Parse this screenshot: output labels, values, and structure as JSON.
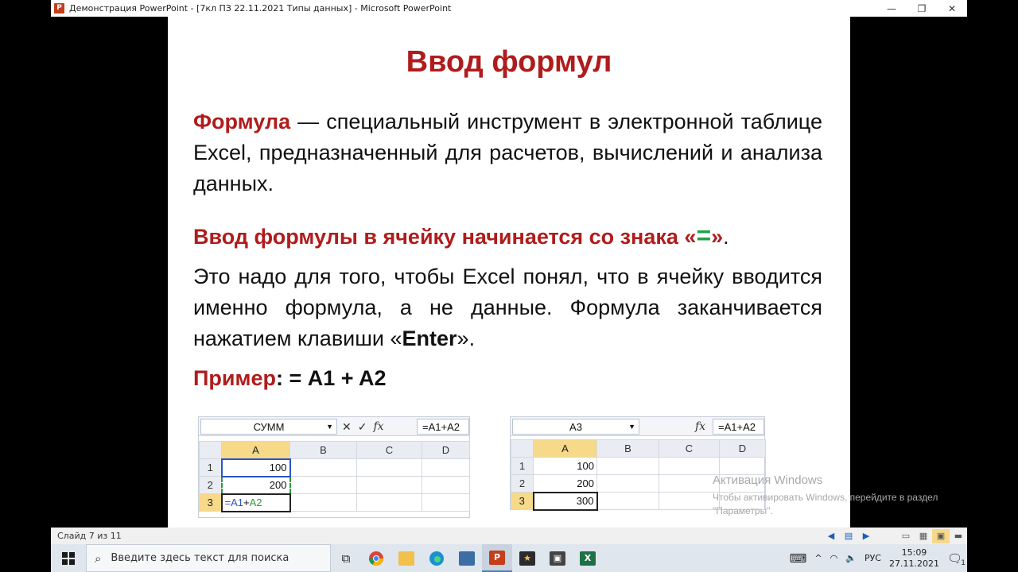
{
  "window": {
    "title": "Демонстрация PowerPoint - [7кл ПЗ 22.11.2021 Типы данных] - Microsoft PowerPoint",
    "app_icon_letter": "P",
    "minimize": "—",
    "restore": "❐",
    "close": "✕"
  },
  "slide": {
    "title": "Ввод формул",
    "p1_term": "Формула",
    "p1_text": " — специальный инструмент в электронной таблице Excel, предназначенный для расчетов, вычислений и анализа данных.",
    "p2_text": "Ввод формулы в ячейку начинается со знака «",
    "p2_sign": "=",
    "p2_close": "»",
    "p2_dot": ".",
    "p3_text": "Это надо для того, чтобы Excel понял, что в ячейку вводится именно формула, а не данные. Формула заканчивается нажатием клавиши «",
    "p3_key": "Enter",
    "p3_end": "».",
    "p4_label": "Пример",
    "p4_formula": ": = A1 + A2"
  },
  "excel_left": {
    "name_box": "СУММ",
    "formula": "=A1+A2",
    "columns": [
      "A",
      "B",
      "C",
      "D"
    ],
    "rows": [
      {
        "num": "1",
        "a": "100"
      },
      {
        "num": "2",
        "a": "200"
      },
      {
        "num": "3",
        "a_ref1": "=A1",
        "a_plus": "+",
        "a_ref2": "A2"
      }
    ],
    "colors": {
      "ref1": "#2a55c8",
      "ref2": "#2a9a3a"
    }
  },
  "excel_right": {
    "name_box": "A3",
    "formula": "=A1+A2",
    "columns": [
      "A",
      "B",
      "C",
      "D"
    ],
    "rows": [
      {
        "num": "1",
        "a": "100"
      },
      {
        "num": "2",
        "a": "200"
      },
      {
        "num": "3",
        "a": "300"
      }
    ]
  },
  "status": {
    "slide_counter": "Слайд 7 из 11"
  },
  "watermark": {
    "line1": "Активация Windows",
    "line2": "Чтобы активировать Windows, перейдите в раздел \"Параметры\"."
  },
  "taskbar": {
    "search_placeholder": "Введите здесь текст для поиска",
    "language": "РУС",
    "time": "15:09",
    "date": "27.11.2021",
    "notification_count": "1"
  }
}
